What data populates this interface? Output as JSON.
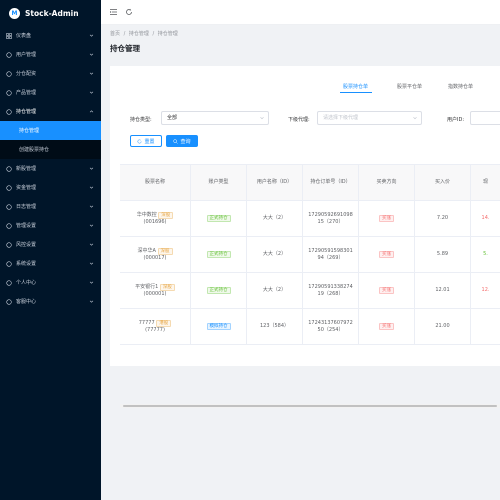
{
  "app": {
    "title": "Stock-Admin",
    "logo_letter": "M"
  },
  "sidebar": {
    "items": [
      {
        "label": "仪表盘",
        "icon": "dashboard-icon"
      },
      {
        "label": "用户管理",
        "icon": "user-icon"
      },
      {
        "label": "分仓配资",
        "icon": "share-icon"
      },
      {
        "label": "产品管理",
        "icon": "product-icon"
      },
      {
        "label": "持仓管理",
        "icon": "position-icon",
        "open": true
      },
      {
        "label": "新股管理",
        "icon": "new-stock-icon"
      },
      {
        "label": "资金管理",
        "icon": "fund-icon"
      },
      {
        "label": "日志管理",
        "icon": "log-icon"
      },
      {
        "label": "管理设置",
        "icon": "manage-icon"
      },
      {
        "label": "风控设置",
        "icon": "risk-icon"
      },
      {
        "label": "系统设置",
        "icon": "settings-icon"
      },
      {
        "label": "个人中心",
        "icon": "person-icon"
      },
      {
        "label": "客服中心",
        "icon": "service-icon"
      }
    ],
    "sub_items": [
      {
        "label": "持仓管理",
        "active": true
      },
      {
        "label": "创建股票持仓",
        "active": false
      }
    ]
  },
  "breadcrumb": [
    "首页",
    "持仓管理",
    "持仓管理"
  ],
  "breadcrumb_sep": "/",
  "page_title": "持仓管理",
  "tabs": [
    {
      "label": "股票持仓单",
      "active": true
    },
    {
      "label": "股票平仓单",
      "active": false
    },
    {
      "label": "指数持仓单",
      "active": false
    }
  ],
  "filters": {
    "account_type_label": "持仓类型:",
    "account_type_value": "全部",
    "agent_label": "下级代理:",
    "agent_placeholder": "请选择下级代理",
    "user_id_label": "用户ID:"
  },
  "buttons": {
    "reset": "重置",
    "search": "查询"
  },
  "table": {
    "headers": [
      "股票名称",
      "账户类型",
      "用户名称（ID）",
      "持仓订单号（ID）",
      "买卖方向",
      "买入价",
      "现"
    ],
    "rows": [
      {
        "stock": "华中数控",
        "code": "(001696)",
        "market": "深股",
        "account": "正式持仓",
        "account_tag": "green",
        "user": "大大（2）",
        "order": "17290592691098 15（270）",
        "direction": "买涨",
        "price": "7.20",
        "now": "14.",
        "now_color": "red"
      },
      {
        "stock": "深中华A",
        "code": "(000017)",
        "market": "深股",
        "account": "正式持仓",
        "account_tag": "green",
        "user": "大大（2）",
        "order": "17290591598301 94（269）",
        "direction": "买涨",
        "price": "5.89",
        "now": "5.",
        "now_color": "green"
      },
      {
        "stock": "平安银行1",
        "code": "(000001)",
        "market": "深股",
        "account": "正式持仓",
        "account_tag": "green",
        "user": "大大（2）",
        "order": "17290591338274 19（268）",
        "direction": "买涨",
        "price": "12.01",
        "now": "12.",
        "now_color": "red"
      },
      {
        "stock": "77777",
        "code": "(77777)",
        "market": "港股",
        "account": "模拟持仓",
        "account_tag": "blue",
        "user": "123（584）",
        "order": "17243137607972 50（254）",
        "direction": "买涨",
        "price": "21.00",
        "now": "",
        "now_color": "red"
      }
    ]
  },
  "colors": {
    "sidebar_bg": "#001529",
    "accent": "#1890ff",
    "submenu_bg": "#000c17"
  }
}
